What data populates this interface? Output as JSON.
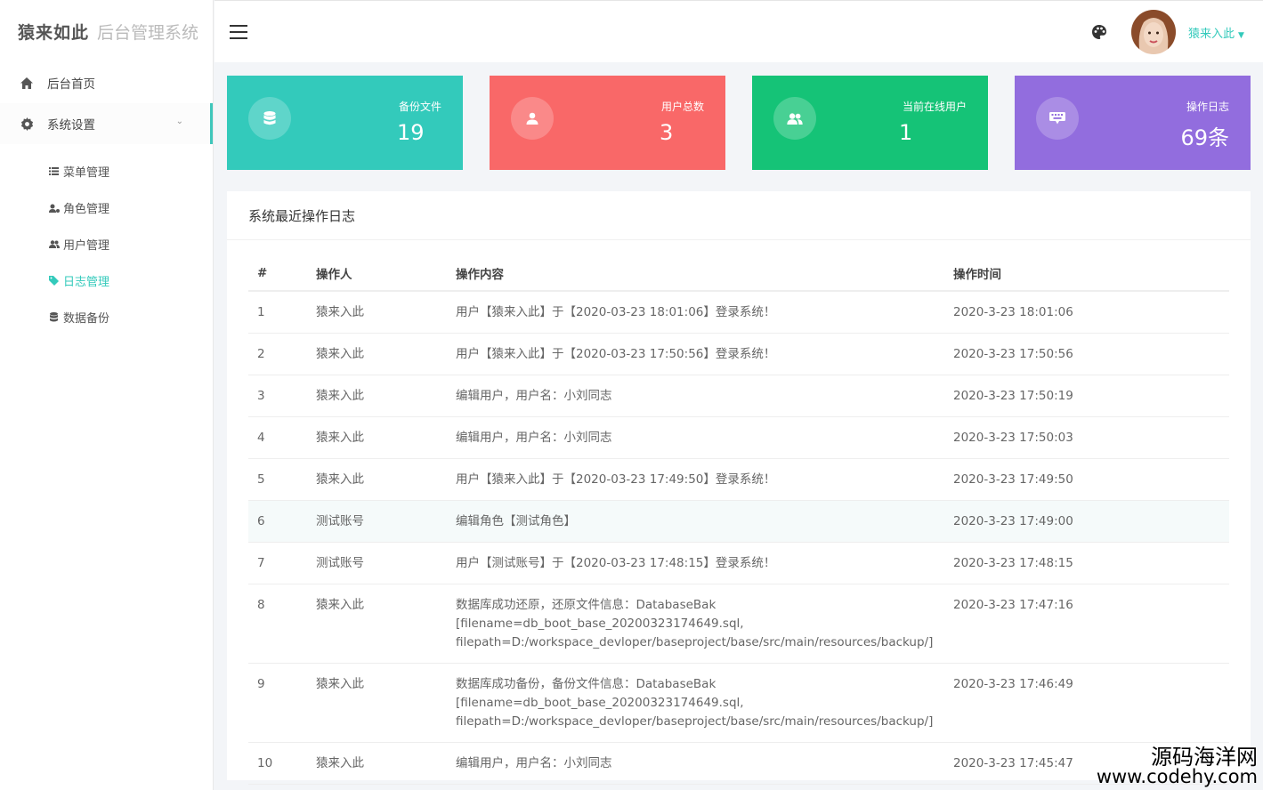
{
  "brand": {
    "bold": "猿来如此",
    "light": "后台管理系统"
  },
  "sidebar": {
    "home": "后台首页",
    "settings": "系统设置",
    "sub_items": [
      {
        "label": "菜单管理",
        "icon": "list-icon"
      },
      {
        "label": "角色管理",
        "icon": "user-cog-icon"
      },
      {
        "label": "用户管理",
        "icon": "users-icon"
      },
      {
        "label": "日志管理",
        "icon": "tag-icon",
        "active": true
      },
      {
        "label": "数据备份",
        "icon": "database-icon"
      }
    ]
  },
  "header": {
    "user_name": "猿来入此"
  },
  "stats": [
    {
      "label": "备份文件",
      "value": "19",
      "color": "#33cabb",
      "icon": "database-icon"
    },
    {
      "label": "用户总数",
      "value": "3",
      "color": "#f96868",
      "icon": "user-icon"
    },
    {
      "label": "当前在线用户",
      "value": "1",
      "color": "#15c377",
      "icon": "users-icon"
    },
    {
      "label": "操作日志",
      "value": "69条",
      "color": "#926dde",
      "icon": "keyboard-icon"
    }
  ],
  "log_panel": {
    "title": "系统最近操作日志",
    "columns": [
      "#",
      "操作人",
      "操作内容",
      "操作时间"
    ],
    "rows": [
      {
        "id": "1",
        "user": "猿来入此",
        "content": "用户【猿来入此】于【2020-03-23 18:01:06】登录系统！",
        "time": "2020-3-23 18:01:06"
      },
      {
        "id": "2",
        "user": "猿来入此",
        "content": "用户【猿来入此】于【2020-03-23 17:50:56】登录系统！",
        "time": "2020-3-23 17:50:56"
      },
      {
        "id": "3",
        "user": "猿来入此",
        "content": "编辑用户，用户名：小刘同志",
        "time": "2020-3-23 17:50:19"
      },
      {
        "id": "4",
        "user": "猿来入此",
        "content": "编辑用户，用户名：小刘同志",
        "time": "2020-3-23 17:50:03"
      },
      {
        "id": "5",
        "user": "猿来入此",
        "content": "用户【猿来入此】于【2020-03-23 17:49:50】登录系统！",
        "time": "2020-3-23 17:49:50"
      },
      {
        "id": "6",
        "user": "测试账号",
        "content": "编辑角色【测试角色】",
        "time": "2020-3-23 17:49:00"
      },
      {
        "id": "7",
        "user": "测试账号",
        "content": "用户【测试账号】于【2020-03-23 17:48:15】登录系统！",
        "time": "2020-3-23 17:48:15"
      },
      {
        "id": "8",
        "user": "猿来入此",
        "content": "数据库成功还原，还原文件信息：DatabaseBak\n[filename=db_boot_base_20200323174649.sql,\nfilepath=D:/workspace_devloper/baseproject/base/src/main/resources/backup/]",
        "time": "2020-3-23 17:47:16"
      },
      {
        "id": "9",
        "user": "猿来入此",
        "content": "数据库成功备份，备份文件信息：DatabaseBak\n[filename=db_boot_base_20200323174649.sql,\nfilepath=D:/workspace_devloper/baseproject/base/src/main/resources/backup/]",
        "time": "2020-3-23 17:46:49"
      },
      {
        "id": "10",
        "user": "猿来入此",
        "content": "编辑用户，用户名：小刘同志",
        "time": "2020-3-23 17:45:47"
      }
    ],
    "highlight_row": "6"
  },
  "watermark": {
    "line1": "源码海洋网",
    "line2": "www.codehy.com"
  },
  "colors": {
    "accent": "#33cabb"
  }
}
